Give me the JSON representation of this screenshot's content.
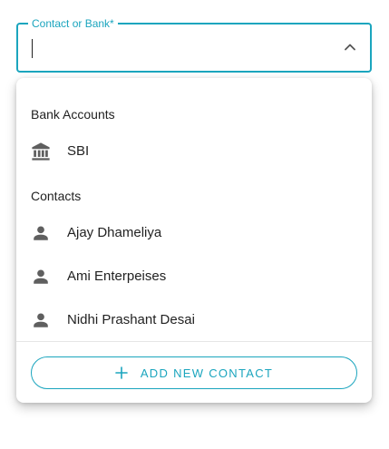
{
  "field": {
    "label": "Contact or Bank*",
    "value": ""
  },
  "menu": {
    "bank_header": "Bank Accounts",
    "banks": [
      {
        "label": "SBI",
        "icon": "bank-icon"
      }
    ],
    "contacts_header": "Contacts",
    "contacts": [
      {
        "label": "Ajay Dhameliya",
        "icon": "person-icon"
      },
      {
        "label": "Ami Enterpeises",
        "icon": "person-icon"
      },
      {
        "label": "Nidhi Prashant Desai",
        "icon": "person-icon"
      }
    ],
    "add_button_label": "ADD NEW CONTACT"
  },
  "colors": {
    "accent": "#1ba5be",
    "icon": "#5f5f5f",
    "text": "#222222"
  }
}
